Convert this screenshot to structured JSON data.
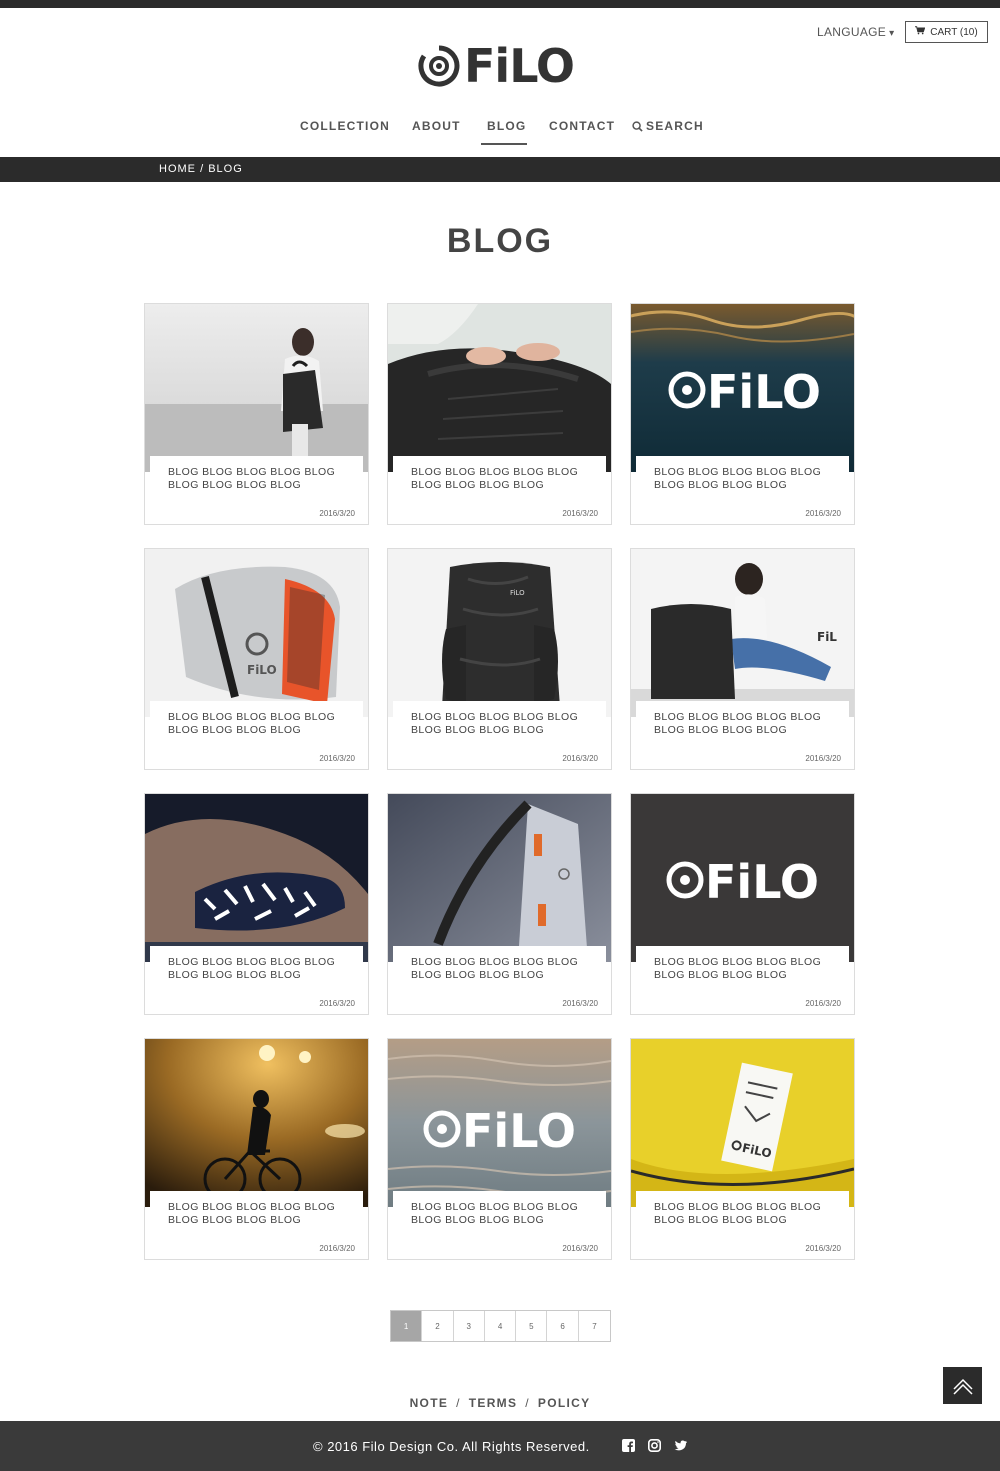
{
  "header": {
    "language_label": "LANGUAGE",
    "language_caret": "▾",
    "cart_label": "CART (10)",
    "logo_text": "FiLO"
  },
  "nav": {
    "items": [
      {
        "label": "COLLECTION"
      },
      {
        "label": "ABOUT"
      },
      {
        "label": "BLOG",
        "active": true
      },
      {
        "label": "CONTACT"
      },
      {
        "label": "SEARCH"
      }
    ]
  },
  "breadcrumb": {
    "home": "HOME",
    "separator": "/",
    "current": "BLOG"
  },
  "page_title": "BLOG",
  "posts": [
    {
      "title": "BLOG BLOG BLOG BLOG BLOG BLOG BLOG BLOG BLOG",
      "date": "2016/3/20",
      "image": "woman-with-backpack-photo"
    },
    {
      "title": "BLOG BLOG BLOG BLOG BLOG BLOG BLOG BLOG BLOG",
      "date": "2016/3/20",
      "image": "hands-opening-backpack-photo"
    },
    {
      "title": "BLOG BLOG BLOG BLOG BLOG BLOG BLOG BLOG BLOG",
      "date": "2016/3/20",
      "image": "filo-logo-on-water",
      "overlay_text": "FiLO"
    },
    {
      "title": "BLOG BLOG BLOG BLOG BLOG BLOG BLOG BLOG BLOG",
      "date": "2016/3/20",
      "image": "grey-orange-messenger-bag-photo"
    },
    {
      "title": "BLOG BLOG BLOG BLOG BLOG BLOG BLOG BLOG BLOG",
      "date": "2016/3/20",
      "image": "black-camo-backpack-photo"
    },
    {
      "title": "BLOG BLOG BLOG BLOG BLOG BLOG BLOG BLOG BLOG",
      "date": "2016/3/20",
      "image": "woman-sitting-with-backpack-photo"
    },
    {
      "title": "BLOG BLOG BLOG BLOG BLOG BLOG BLOG BLOG BLOG",
      "date": "2016/3/20",
      "image": "reflective-bracelet-photo"
    },
    {
      "title": "BLOG BLOG BLOG BLOG BLOG BLOG BLOG BLOG BLOG",
      "date": "2016/3/20",
      "image": "grey-bag-orange-straps-photo"
    },
    {
      "title": "BLOG BLOG BLOG BLOG BLOG BLOG BLOG BLOG BLOG",
      "date": "2016/3/20",
      "image": "filo-logo-dark",
      "overlay_text": "FiLO"
    },
    {
      "title": "BLOG BLOG BLOG BLOG BLOG BLOG BLOG BLOG BLOG",
      "date": "2016/3/20",
      "image": "cyclist-in-fog-photo"
    },
    {
      "title": "BLOG BLOG BLOG BLOG BLOG BLOG BLOG BLOG BLOG",
      "date": "2016/3/20",
      "image": "filo-logo-on-sea",
      "overlay_text": "FiLO"
    },
    {
      "title": "BLOG BLOG BLOG BLOG BLOG BLOG BLOG BLOG BLOG",
      "date": "2016/3/20",
      "image": "yellow-bag-label-photo"
    }
  ],
  "pagination": {
    "pages": [
      "1",
      "2",
      "3",
      "4",
      "5",
      "6",
      "7"
    ],
    "current": "1"
  },
  "footer": {
    "links": [
      "NOTE",
      "TERMS",
      "POLICY"
    ],
    "link_separator": "/",
    "copyright": "© 2016 Filo Design Co. All Rights Reserved.",
    "social_icons": [
      "facebook-icon",
      "instagram-icon",
      "twitter-icon"
    ]
  },
  "colors": {
    "dark_bar": "#2b2b2b",
    "footer_bg": "#3a3a3a",
    "text": "#444444",
    "pager_active": "#a6a6a6"
  }
}
